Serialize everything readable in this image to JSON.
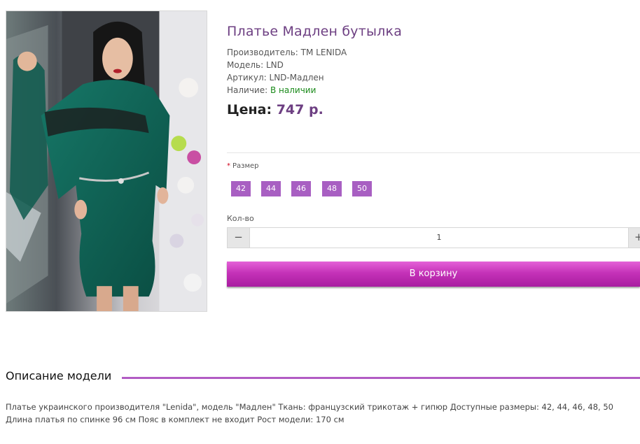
{
  "product": {
    "title": "Платье Мадлен бутылка",
    "manufacturer_label": "Производитель:",
    "manufacturer": "TM LENIDA",
    "model_label": "Модель:",
    "model": "LND",
    "sku_label": "Артикул:",
    "sku": "LND-Мадлен",
    "availability_label": "Наличие:",
    "availability": "В наличии",
    "price_label": "Цена:",
    "price": "747 р."
  },
  "options": {
    "size_required_mark": "*",
    "size_label": "Размер",
    "sizes": [
      "42",
      "44",
      "46",
      "48",
      "50"
    ]
  },
  "quantity": {
    "label": "Кол-во",
    "minus": "−",
    "value": "1",
    "plus": "+"
  },
  "cart_button": "В корзину",
  "description": {
    "heading": "Описание модели",
    "text": "Платье украинского производителя \"Lenida\", модель \"Мадлен\" Ткань: французский трикотаж + гипюр Доступные размеры: 42, 44, 46, 48, 50 Длина платья по спинке 96 см Пояс в комплект не входит Рост модели: 170 см"
  },
  "colors": {
    "accent": "#a85fc2",
    "title": "#6d3f82",
    "in_stock": "#1a8a1a",
    "cart_button": "#c532b8",
    "dress": "#0f5e50"
  }
}
